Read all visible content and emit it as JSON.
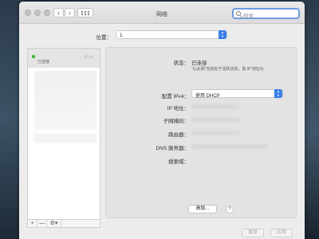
{
  "window": {
    "title": "网络"
  },
  "search": {
    "placeholder": "搜索"
  },
  "location": {
    "label": "位置：",
    "value": "1"
  },
  "service": {
    "name": "",
    "status": "已连接",
    "icon": "ethernet-arrows-icon"
  },
  "sidebar_tools": {
    "add": "+",
    "remove": "—",
    "action": "⚙︎▾"
  },
  "details": {
    "status_label": "状态：",
    "status_value": "已连接",
    "status_note": "“以太网”当前处于活跃状态，其 IP 地址为",
    "config_label": "配置 IPv4：",
    "config_value": "使用 DHCP",
    "ip_label": "IP 地址：",
    "mask_label": "子网掩码：",
    "router_label": "路由器：",
    "dns_label": "DNS 服务器：",
    "search_domain_label": "搜索域："
  },
  "buttons": {
    "advanced": "高级...",
    "help": "?",
    "revert": "复原",
    "apply": "应用"
  },
  "colors": {
    "accent": "#3a7ee8",
    "status_green": "#2fb52f"
  }
}
